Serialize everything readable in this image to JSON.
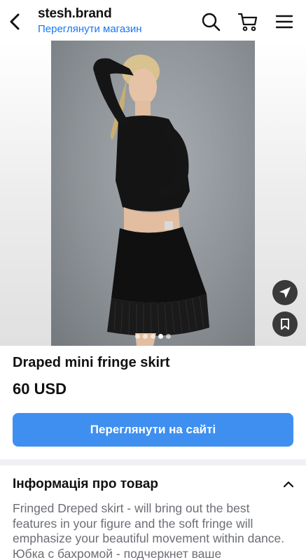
{
  "header": {
    "shop_name": "stesh.brand",
    "shop_link": "Переглянути магазин"
  },
  "gallery": {
    "image_count": 5,
    "active_index": 3
  },
  "product": {
    "title": "Draped mini fringe skirt",
    "price": "60 USD",
    "cta_label": "Переглянути на сайті"
  },
  "info": {
    "title": "Інформація про товар",
    "description": "Fringed Dreped skirt - will bring out the best features in your figure and the soft fringe will emphasize your beautiful movement within dance. Юбка с бахромой - подчеркнет ваше"
  },
  "colors": {
    "accent": "#1877f2",
    "button": "#3f8ff0",
    "float_button": "#3a3a3a"
  }
}
